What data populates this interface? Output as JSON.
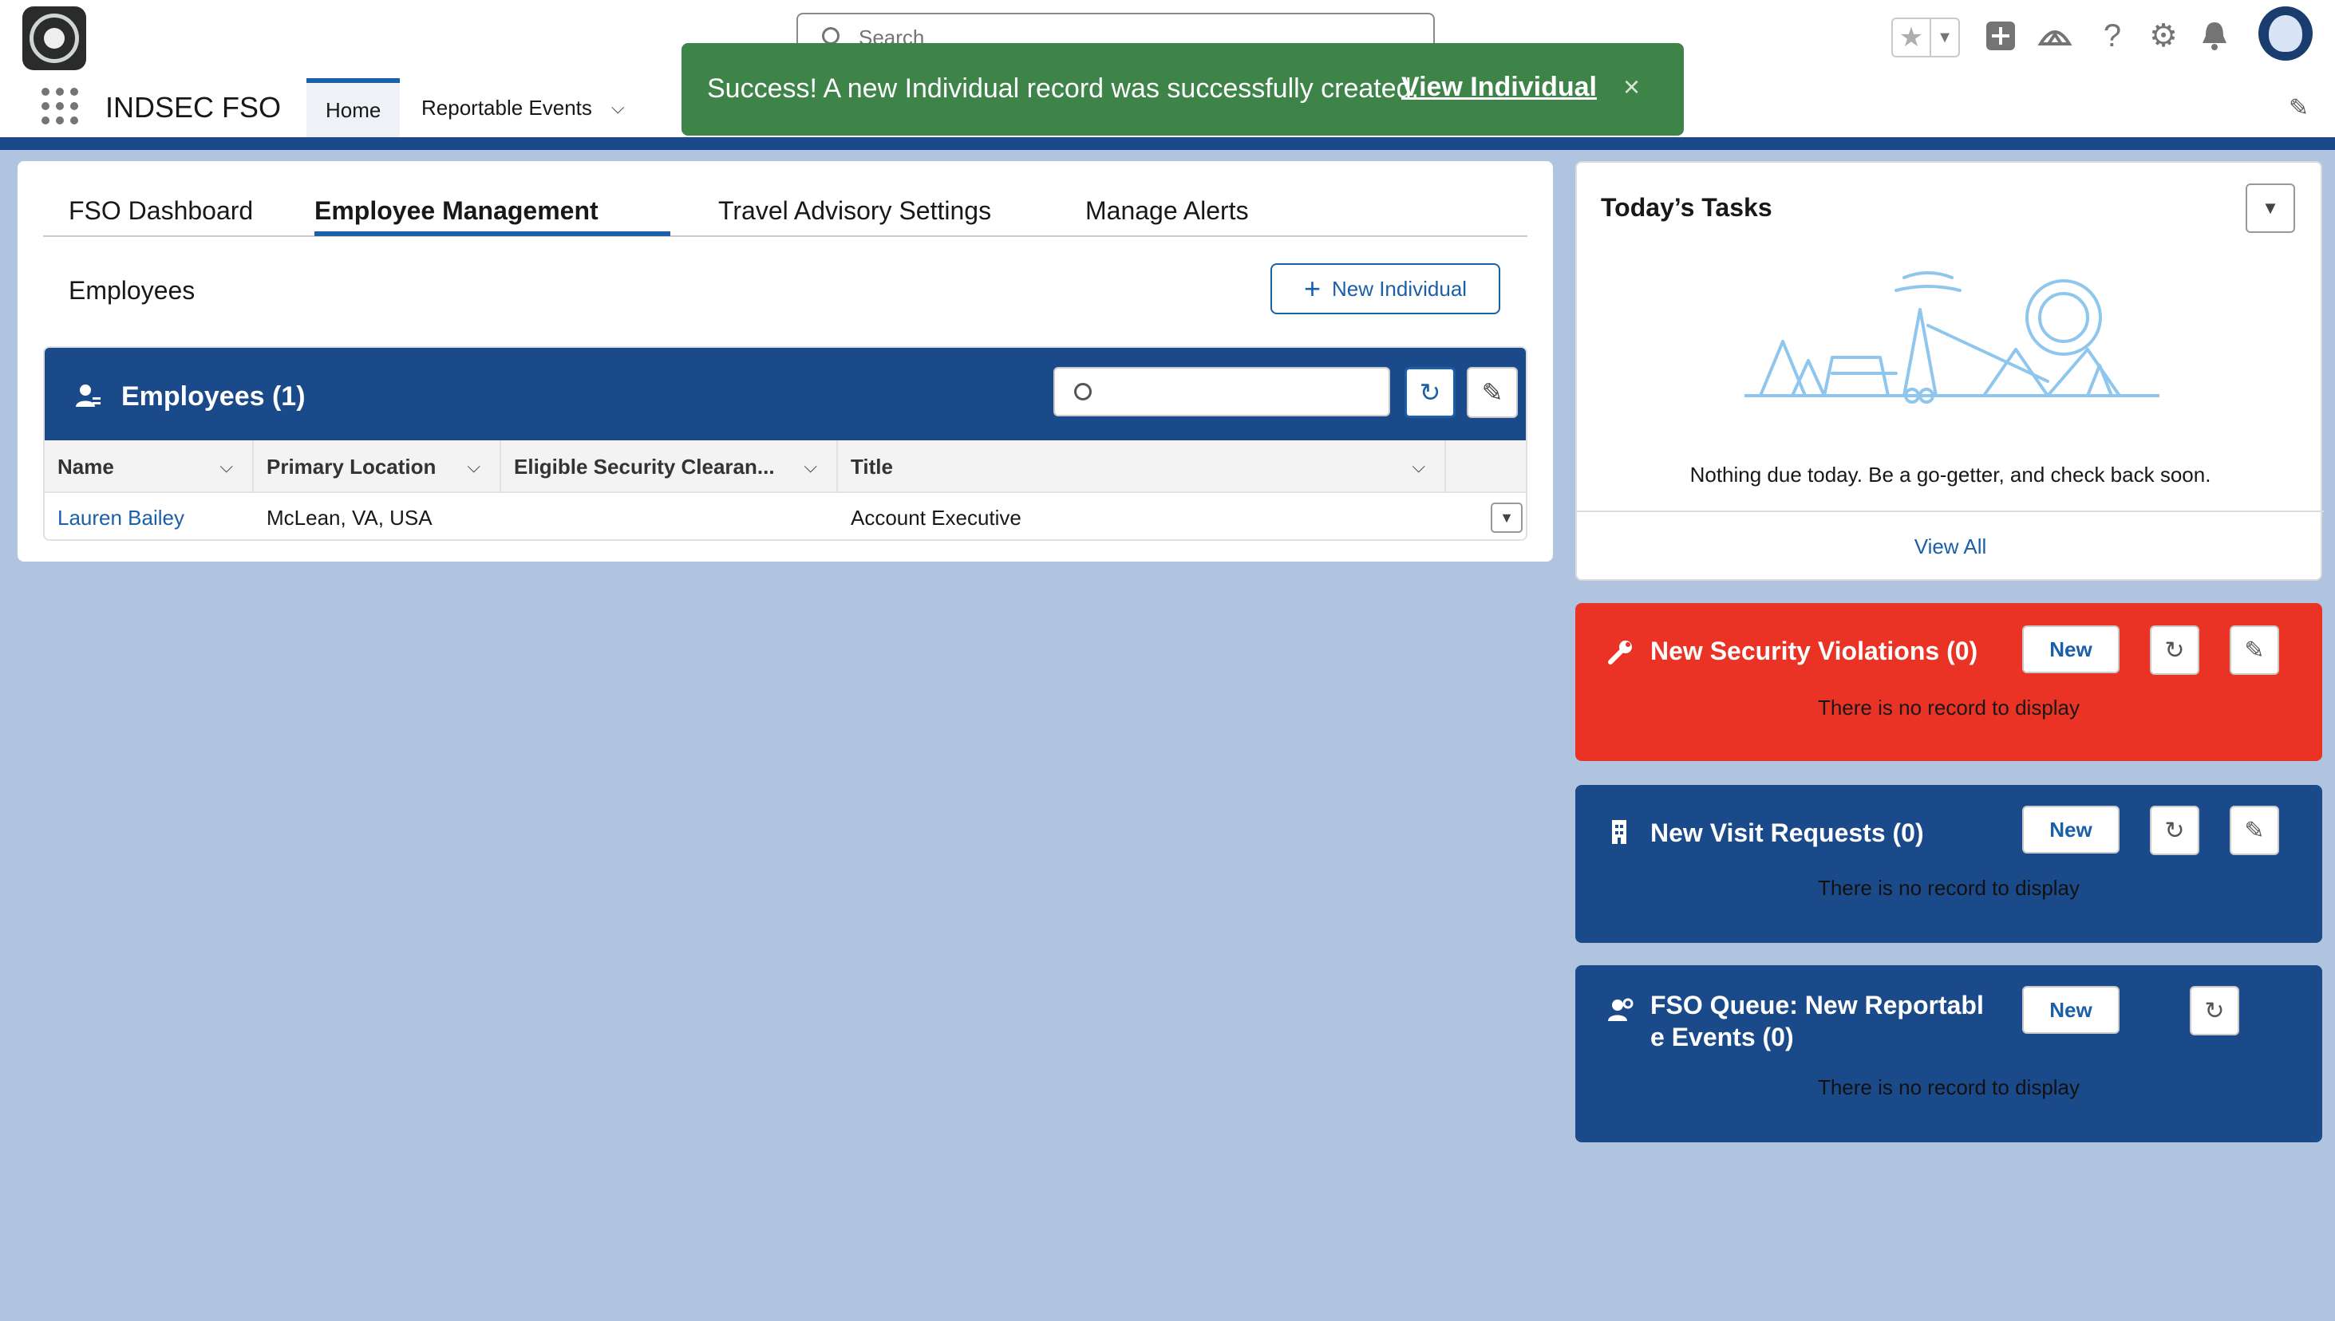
{
  "header": {
    "search_placeholder": "Search",
    "app_name": "INDSEC FSO",
    "nav": [
      {
        "label": "Home"
      },
      {
        "label": "Reportable Events"
      }
    ]
  },
  "toast": {
    "message": "Success! A new Individual record was successfully created.",
    "link": "View Individual",
    "close": "×"
  },
  "main": {
    "tabs": [
      {
        "label": "FSO Dashboard"
      },
      {
        "label": "Employee Management"
      },
      {
        "label": "Travel Advisory Settings"
      },
      {
        "label": "Manage Alerts"
      }
    ],
    "employees_heading": "Employees",
    "new_individual_label": "New Individual",
    "list": {
      "title": "Employees (1)",
      "columns": [
        "Name",
        "Primary Location",
        "Eligible Security Clearan...",
        "Title"
      ],
      "rows": [
        {
          "name": "Lauren Bailey",
          "location": "McLean, VA, USA",
          "clearance": "",
          "title": "Account Executive"
        }
      ]
    }
  },
  "tasks": {
    "title": "Today’s Tasks",
    "empty_message": "Nothing due today. Be a go-getter, and check back soon.",
    "view_all": "View All"
  },
  "violations": {
    "title": "New Security Violations (0)",
    "new_label": "New",
    "empty": "There is no record to display",
    "color": "#ea3324"
  },
  "visits": {
    "title": "New Visit Requests (0)",
    "new_label": "New",
    "empty": "There is no record to display",
    "color": "#1b4a8b"
  },
  "queue": {
    "title_line1": "FSO Queue: New Reportabl",
    "title_line2": "e Events (0)",
    "new_label": "New",
    "empty": "There is no record to display",
    "color": "#1b4a8b"
  },
  "colors": {
    "brand": "#1b4a8b",
    "link": "#1b5fa8",
    "toast_success": "#3e8449",
    "background": "#b0c3df"
  }
}
